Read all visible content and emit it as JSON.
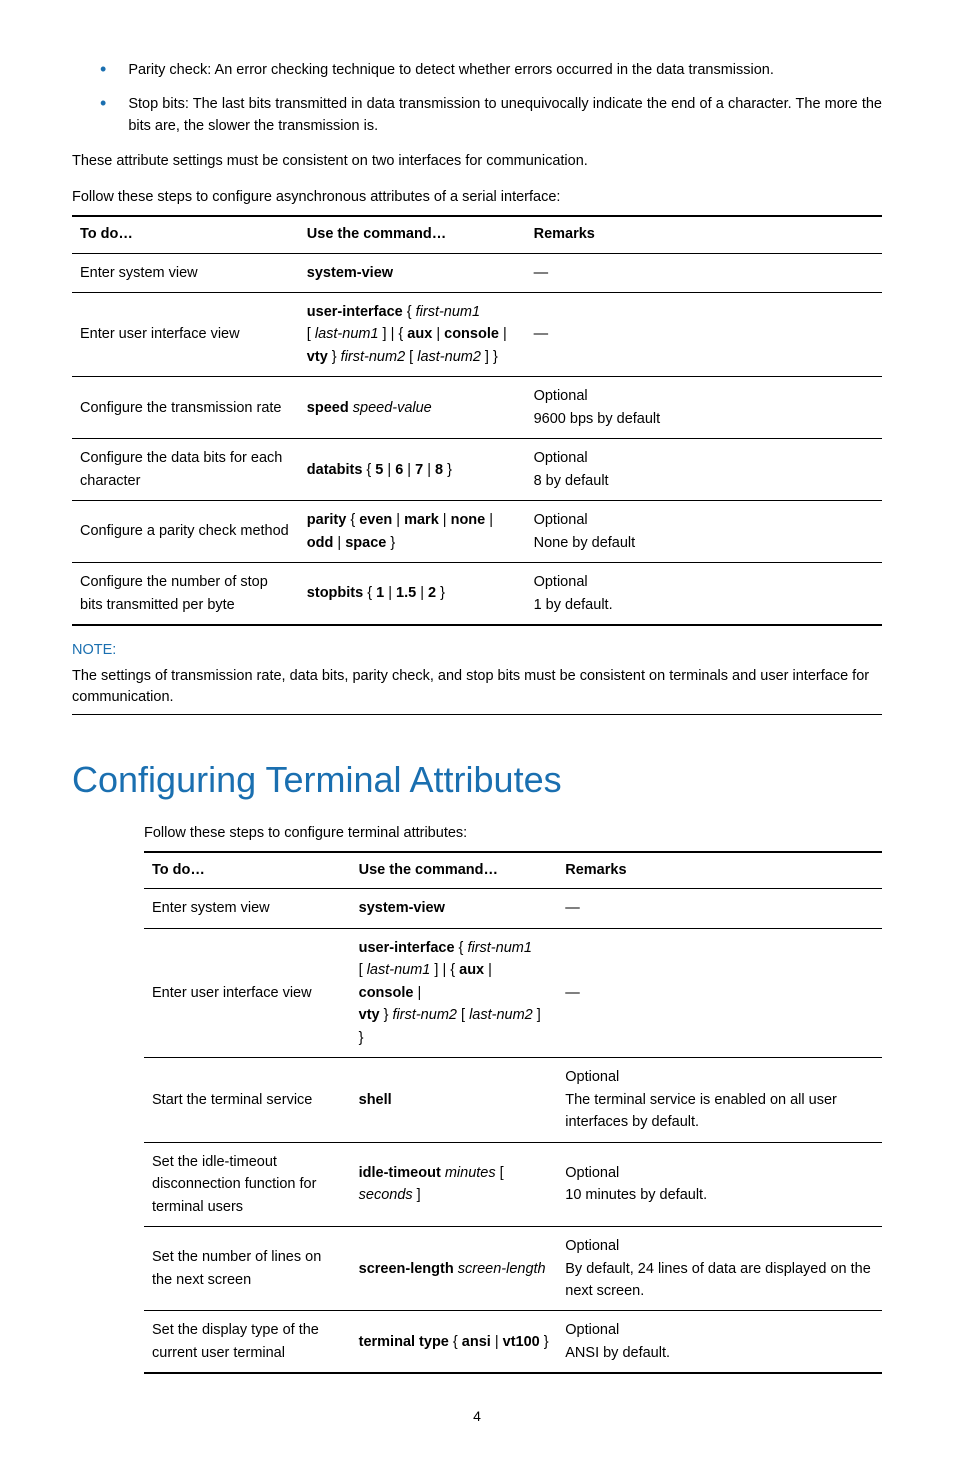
{
  "bullets": [
    "Parity check: An error checking technique to detect whether errors occurred in the data transmission.",
    "Stop bits: The last bits transmitted in data transmission to unequivocally indicate the end of a character. The more the bits are, the slower the transmission is."
  ],
  "para_after_bullets": "These attribute settings must be consistent on two interfaces for communication.",
  "table1_intro": "Follow these steps to configure asynchronous attributes of a serial interface:",
  "headers": {
    "c1": "To do…",
    "c2": "Use the command…",
    "c3": "Remarks"
  },
  "t1": {
    "r1": {
      "c1": "Enter system view",
      "c3": "—"
    },
    "r2": {
      "c1": "Enter user interface view",
      "c3": "—"
    },
    "r3": {
      "c1": "Configure the transmission rate",
      "c3a": "Optional",
      "c3b": "9600 bps by default"
    },
    "r4": {
      "c1": "Configure the data bits for each character",
      "c3a": "Optional",
      "c3b": "8 by default"
    },
    "r5": {
      "c1": "Configure a parity check method",
      "c3a": "Optional",
      "c3b": "None by default"
    },
    "r6": {
      "c1": "Configure the number of stop bits transmitted per byte",
      "c3a": "Optional",
      "c3b": "1 by default."
    }
  },
  "cmd": {
    "system_view": "system-view",
    "user_interface": "user-interface",
    "aux": "aux",
    "console": "console",
    "vty": "vty",
    "first_num1": "first-num1",
    "last_num1": "last-num1",
    "first_num2": "first-num2",
    "last_num2": "last-num2",
    "speed": "speed",
    "speed_value": "speed-value",
    "databits": "databits",
    "d5": "5",
    "d6": "6",
    "d7": "7",
    "d8": "8",
    "parity": "parity",
    "even": "even",
    "mark": "mark",
    "none": "none",
    "odd": "odd",
    "space": "space",
    "stopbits": "stopbits",
    "s1": "1",
    "s15": "1.5",
    "s2": "2",
    "shell": "shell",
    "idle_timeout": "idle-timeout",
    "minutes": "minutes",
    "seconds": "seconds",
    "screen_length": "screen-length",
    "screen_length_arg": "screen-length",
    "terminal_type": "terminal type",
    "ansi": "ansi",
    "vt100": "vt100"
  },
  "note": {
    "head": "NOTE:",
    "body": "The settings of transmission rate, data bits, parity check, and stop bits must be consistent on terminals and user interface for communication."
  },
  "section_title": "Configuring Terminal Attributes",
  "table2_intro": "Follow these steps to configure terminal attributes:",
  "t2": {
    "r1": {
      "c1": "Enter system view",
      "c3": "—"
    },
    "r2": {
      "c1": "Enter user interface view",
      "c3": "—"
    },
    "r3": {
      "c1": "Start the terminal service",
      "c3a": "Optional",
      "c3b": "The terminal service is enabled on all user interfaces by default."
    },
    "r4": {
      "c1": "Set the idle-timeout disconnection function for terminal users",
      "c3a": "Optional",
      "c3b": "10 minutes by default."
    },
    "r5": {
      "c1": "Set the number of lines on the next screen",
      "c3a": "Optional",
      "c3b": "By default, 24 lines of data are displayed on the next screen."
    },
    "r6": {
      "c1": "Set the display type of the current user terminal",
      "c3a": "Optional",
      "c3b": "ANSI by default."
    }
  },
  "page_number": "4"
}
